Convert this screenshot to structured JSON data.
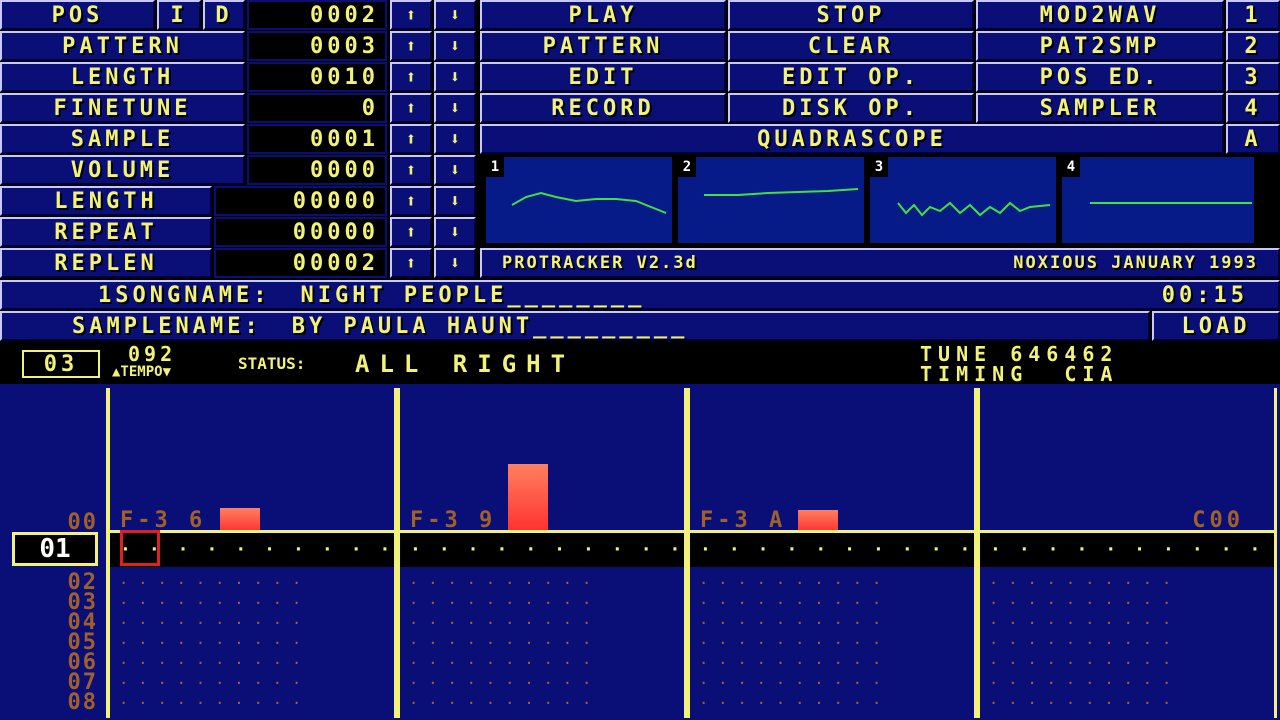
{
  "top_left": {
    "pos_label": "POS",
    "i_label": "I",
    "d_label": "D",
    "pos_value": "0002",
    "pattern_label": "PATTERN",
    "pattern_value": "0003",
    "length_label": "LENGTH",
    "length_value": "0010",
    "finetune_label": "FINETUNE",
    "finetune_value": "0",
    "sample_label": "SAMPLE",
    "sample_value": "0001",
    "volume_label": "VOLUME",
    "volume_value": "0000",
    "slength_label": "LENGTH",
    "slength_value": "00000",
    "repeat_label": "REPEAT",
    "repeat_value": "00000",
    "replen_label": "REPLEN",
    "replen_value": "00002",
    "up_arrow": "⬆",
    "down_arrow": "⬇"
  },
  "buttons": {
    "play": "PLAY",
    "stop": "STOP",
    "mod2wav": "MOD2WAV",
    "n1": "1",
    "pattern": "PATTERN",
    "clear": "CLEAR",
    "pat2smp": "PAT2SMP",
    "n2": "2",
    "edit": "EDIT",
    "edit_op": "EDIT OP.",
    "pos_ed": "POS ED.",
    "n3": "3",
    "record": "RECORD",
    "disk_op": "DISK OP.",
    "sampler": "SAMPLER",
    "n4": "4",
    "quadrascope": "QUADRASCOPE",
    "a": "A"
  },
  "scope_labels": [
    "1",
    "2",
    "3",
    "4"
  ],
  "info": {
    "version": "PROTRACKER V2.3d",
    "credit": "NOXIOUS JANUARY 1993"
  },
  "song": {
    "label": "1SONGNAME:",
    "name": "NIGHT PEOPLE________",
    "time": "00:15"
  },
  "samplename": {
    "label": "SAMPLENAME:",
    "name": "BY PAULA HAUNT_________",
    "load": "LOAD"
  },
  "status": {
    "pattern_num": "03",
    "tempo_value": "092",
    "tempo_label": "▲TEMPO▼",
    "status_label": "STATUS:",
    "status_text": "ALL RIGHT",
    "tune": "TUNE 646462",
    "timing": "TIMING  CIA"
  },
  "rows": [
    "00",
    "01",
    "02",
    "03",
    "04",
    "05",
    "06",
    "07",
    "08"
  ],
  "current_row": "01",
  "channels": [
    {
      "note": "F-3  6",
      "vu": 0.15
    },
    {
      "note": "F-3  9",
      "vu": 0.45
    },
    {
      "note": "F-3  A",
      "vu": 0.12
    },
    {
      "note": "    C00",
      "vu": 0.0
    }
  ],
  "colors": {
    "panel": "#0a0f78",
    "text": "#f2f27a",
    "scope_wave": "#40e040"
  }
}
